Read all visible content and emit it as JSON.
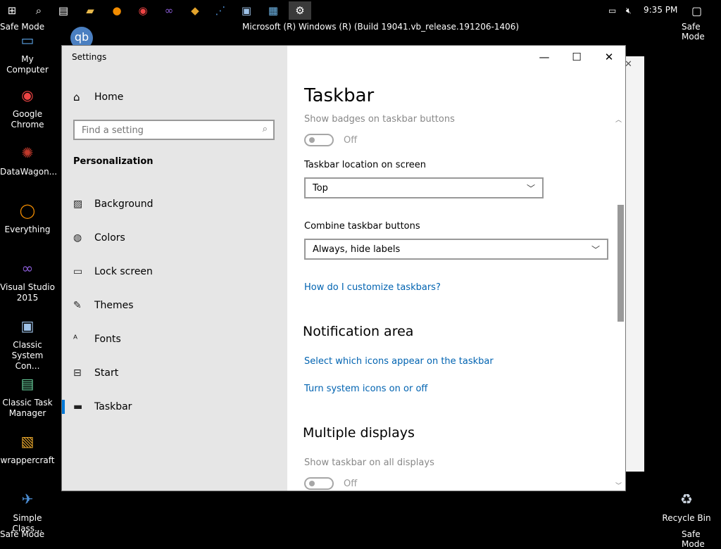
{
  "taskbar": {
    "icons": [
      {
        "name": "start-button",
        "glyph": "⊞"
      },
      {
        "name": "search-button",
        "glyph": "⌕"
      },
      {
        "name": "task-view-button",
        "glyph": "▤"
      },
      {
        "name": "file-explorer-taskbar",
        "glyph": "▰"
      },
      {
        "name": "everything-taskbar",
        "glyph": "●"
      },
      {
        "name": "chrome-taskbar",
        "glyph": "◉"
      },
      {
        "name": "visual-studio-taskbar",
        "glyph": "∞"
      },
      {
        "name": "app-taskbar",
        "glyph": "◆"
      },
      {
        "name": "network-app-taskbar",
        "glyph": "⋰"
      },
      {
        "name": "system-config-taskbar",
        "glyph": "▣"
      },
      {
        "name": "control-panel-taskbar",
        "glyph": "▦"
      },
      {
        "name": "settings-taskbar",
        "glyph": "⚙"
      }
    ],
    "clock": "9:35 PM"
  },
  "desktop": {
    "safe_mode": "Safe Mode",
    "build": "Microsoft (R) Windows (R) (Build 19041.vb_release.191206-1406)",
    "icons": [
      {
        "label": "My Computer"
      },
      {
        "label": "Google Chrome"
      },
      {
        "label": "DataWagon..."
      },
      {
        "label": "Everything"
      },
      {
        "label": "Visual Studio 2015"
      },
      {
        "label": "Classic System Con..."
      },
      {
        "label": "Classic Task Manager"
      },
      {
        "label": "wrappercraft"
      },
      {
        "label": "Simple Class..."
      },
      {
        "label": "Recycle Bin"
      }
    ],
    "qb_icon": "qb"
  },
  "settings": {
    "window_title": "Settings",
    "home_label": "Home",
    "search_placeholder": "Find a setting",
    "category": "Personalization",
    "nav": [
      {
        "label": "Background",
        "icon": "picture-icon"
      },
      {
        "label": "Colors",
        "icon": "palette-icon"
      },
      {
        "label": "Lock screen",
        "icon": "lock-screen-icon"
      },
      {
        "label": "Themes",
        "icon": "themes-icon"
      },
      {
        "label": "Fonts",
        "icon": "fonts-icon"
      },
      {
        "label": "Start",
        "icon": "start-icon"
      },
      {
        "label": "Taskbar",
        "icon": "taskbar-icon",
        "selected": true
      }
    ],
    "page_title": "Taskbar",
    "badges_label": "Show badges on taskbar buttons",
    "badges_state": "Off",
    "location_label": "Taskbar location on screen",
    "location_value": "Top",
    "combine_label": "Combine taskbar buttons",
    "combine_value": "Always, hide labels",
    "help_link": "How do I customize taskbars?",
    "notification_heading": "Notification area",
    "link_select_icons": "Select which icons appear on the taskbar",
    "link_system_icons": "Turn system icons on or off",
    "multi_heading": "Multiple displays",
    "multi_label": "Show taskbar on all displays",
    "multi_state": "Off"
  },
  "colors": {
    "accent": "#0078d7",
    "link": "#0063b1"
  }
}
